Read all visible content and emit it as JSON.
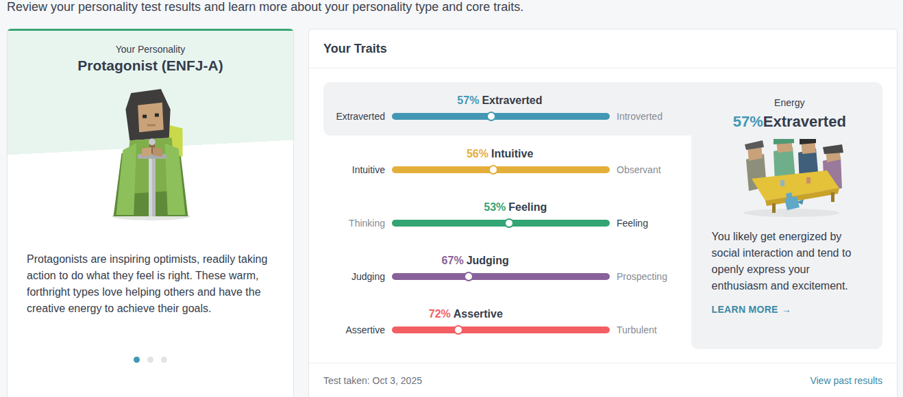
{
  "header": {
    "text": "Review your personality test results and learn more about your personality type and core traits."
  },
  "personality": {
    "label": "Your Personality",
    "name": "Protagonist (ENFJ-A)",
    "description": "Protagonists are inspiring optimists, readily taking action to do what they feel is right. These warm, forthright types love helping others and have the creative energy to achieve their goals.",
    "pages": [
      {
        "selected": true
      },
      {
        "selected": false
      },
      {
        "selected": false
      }
    ]
  },
  "traits_panel": {
    "title": "Your Traits",
    "traits": [
      {
        "percent": "57%",
        "name": "Extraverted",
        "left": {
          "label": "Extraverted",
          "emphasized": true
        },
        "right": {
          "label": "Introverted",
          "emphasized": false
        },
        "level": 0.456,
        "color": "#4298b4",
        "selected": true
      },
      {
        "percent": "56%",
        "name": "Intuitive",
        "left": {
          "label": "Intuitive",
          "emphasized": true
        },
        "right": {
          "label": "Observant",
          "emphasized": false
        },
        "level": 0.465,
        "color": "#e4ae3a",
        "selected": false
      },
      {
        "percent": "53%",
        "name": "Feeling",
        "left": {
          "label": "Thinking",
          "emphasized": false
        },
        "right": {
          "label": "Feeling",
          "emphasized": true
        },
        "level": 0.538,
        "color": "#33a474",
        "selected": false
      },
      {
        "percent": "67%",
        "name": "Judging",
        "left": {
          "label": "Judging",
          "emphasized": true
        },
        "right": {
          "label": "Prospecting",
          "emphasized": false
        },
        "level": 0.352,
        "color": "#88619a",
        "selected": false
      },
      {
        "percent": "72%",
        "name": "Assertive",
        "left": {
          "label": "Assertive",
          "emphasized": true
        },
        "right": {
          "label": "Turbulent",
          "emphasized": false
        },
        "level": 0.305,
        "color": "#f25e62",
        "selected": false
      }
    ]
  },
  "detail": {
    "category": "Energy",
    "percent": "57%",
    "name": "Extraverted",
    "description": "You likely get energized by social interaction and tend to openly express your enthusiasm and excitement.",
    "link": "LEARN MORE",
    "link_icon": "→"
  },
  "footer": {
    "taken": "Test taken: Oct 3, 2025",
    "link": "View past results"
  }
}
